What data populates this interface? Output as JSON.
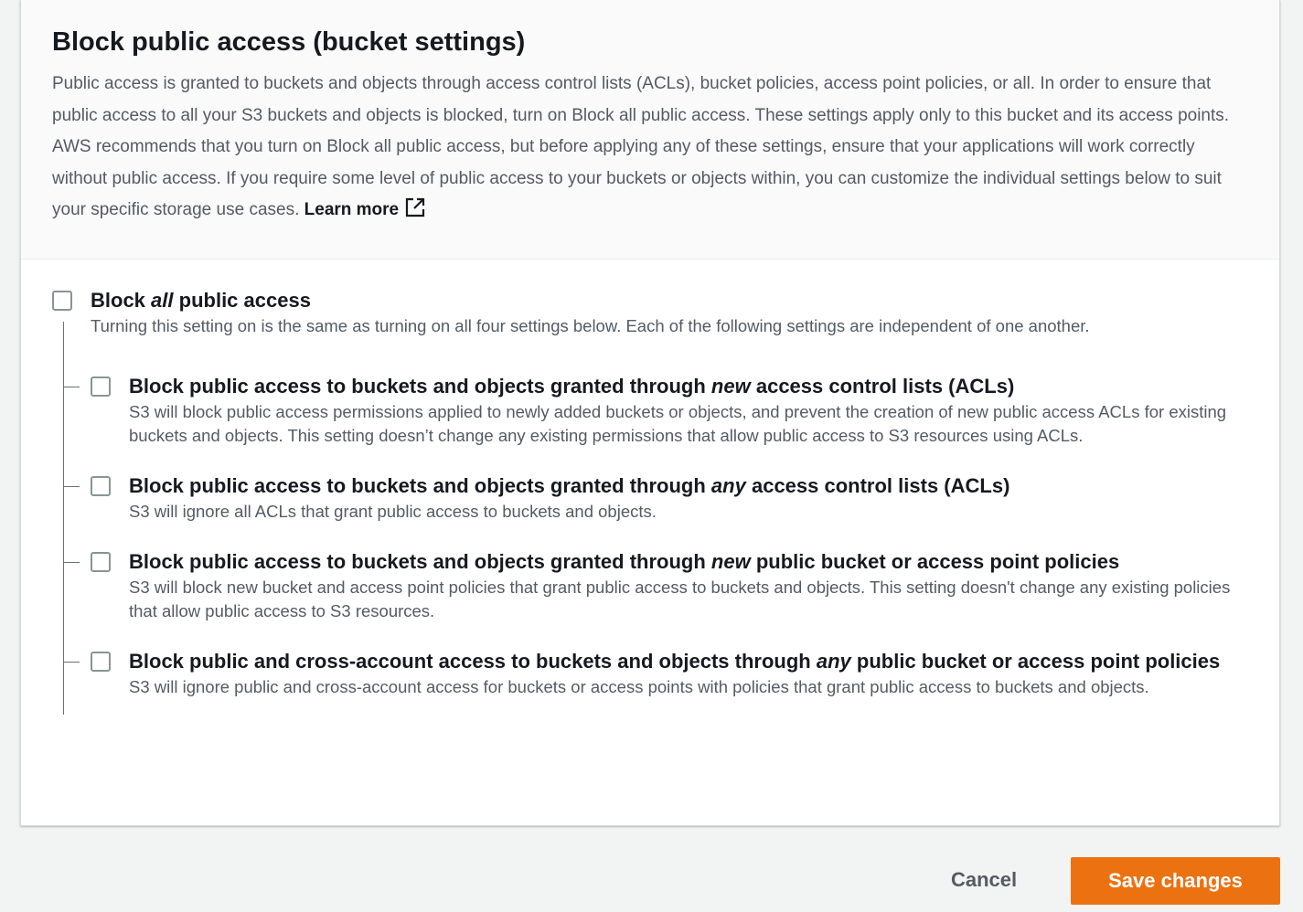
{
  "section": {
    "title": "Block public access (bucket settings)",
    "description": "Public access is granted to buckets and objects through access control lists (ACLs), bucket policies, access point policies, or all. In order to ensure that public access to all your S3 buckets and objects is blocked, turn on Block all public access. These settings apply only to this bucket and its access points. AWS recommends that you turn on Block all public access, but before applying any of these settings, ensure that your applications will work correctly without public access. If you require some level of public access to your buckets or objects within, you can customize the individual settings below to suit your specific storage use cases.",
    "learn_more": "Learn more",
    "learn_more_icon": "external-link-icon"
  },
  "block_all": {
    "label_prefix": "Block",
    "label_em": "all",
    "label_suffix": "public access",
    "description": "Turning this setting on is the same as turning on all four settings below. Each of the following settings are independent of one another.",
    "checked": false
  },
  "options": [
    {
      "prefix": "Block public access to buckets and objects granted through",
      "em": "new",
      "suffix": "access control lists (ACLs)",
      "description": "S3 will block public access permissions applied to newly added buckets or objects, and prevent the creation of new public access ACLs for existing buckets and objects. This setting doesn’t change any existing permissions that allow public access to S3 resources using ACLs.",
      "checked": false
    },
    {
      "prefix": "Block public access to buckets and objects granted through",
      "em": "any",
      "suffix": "access control lists (ACLs)",
      "description": "S3 will ignore all ACLs that grant public access to buckets and objects.",
      "checked": false
    },
    {
      "prefix": "Block public access to buckets and objects granted through",
      "em": "new",
      "suffix": "public bucket or access point policies",
      "description": "S3 will block new bucket and access point policies that grant public access to buckets and objects. This setting doesn't change any existing policies that allow public access to S3 resources.",
      "checked": false
    },
    {
      "prefix": "Block public and cross-account access to buckets and objects through",
      "em": "any",
      "suffix": "public bucket or access point policies",
      "description": "S3 will ignore public and cross-account access for buckets or access points with policies that grant public access to buckets and objects.",
      "checked": false
    }
  ],
  "footer": {
    "cancel_label": "Cancel",
    "save_label": "Save changes"
  },
  "colors": {
    "accent": "#ec7211",
    "text": "#16191f",
    "muted": "#545b64"
  }
}
